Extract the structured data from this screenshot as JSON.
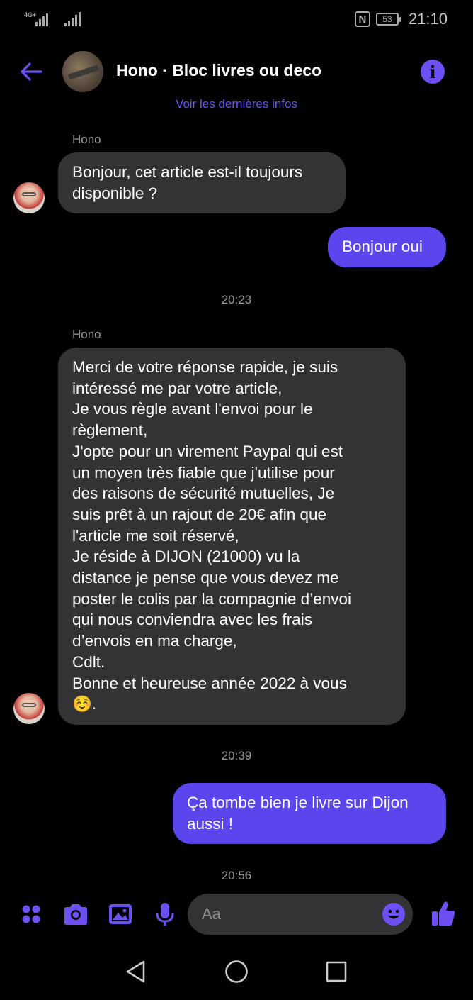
{
  "status_bar": {
    "network": "4G+",
    "battery": "53",
    "time": "21:10"
  },
  "header": {
    "title": "Hono · Bloc livres ou deco",
    "see_more": "Voir les dernières infos"
  },
  "messages": [
    {
      "sender": "Hono",
      "lines": [
        "Bonjour, cet article est-il toujours",
        "disponible ?"
      ]
    },
    {
      "text": "Bonjour oui"
    },
    {
      "timestamp": "20:23"
    },
    {
      "sender": "Hono",
      "lines": [
        "Merci de votre réponse rapide, je suis",
        "intéressé me par votre article,",
        "Je vous règle avant l'envoi pour le",
        "règlement,",
        "J'opte pour un virement Paypal qui est",
        "un moyen très fiable que j'utilise pour",
        "des raisons de sécurité mutuelles, Je",
        "suis prêt à un rajout de 20€ afin que",
        "l'article me soit réservé,",
        "Je réside à DIJON (21000) vu la",
        "distance je pense que vous devez me",
        "poster le colis par la compagnie d’envoi",
        "qui nous conviendra avec les frais",
        "d’envois en ma charge,",
        "Cdlt.",
        "Bonne et heureuse année 2022 à vous",
        "☺️."
      ]
    },
    {
      "timestamp": "20:39"
    },
    {
      "lines": [
        "Ça tombe bien je livre sur Dijon",
        "aussi !"
      ]
    },
    {
      "timestamp": "20:56"
    }
  ],
  "composer": {
    "placeholder": "Aa"
  },
  "colors": {
    "accent": "#6e4ff4",
    "outgoing_bubble": "#5b46ee",
    "incoming_bubble": "#333336",
    "background": "#000000"
  },
  "icons": [
    "back-arrow-icon",
    "info-icon",
    "apps-icon",
    "camera-icon",
    "gallery-icon",
    "microphone-icon",
    "emoji-icon",
    "thumbs-up-icon",
    "nav-back-icon",
    "nav-home-icon",
    "nav-recents-icon"
  ]
}
